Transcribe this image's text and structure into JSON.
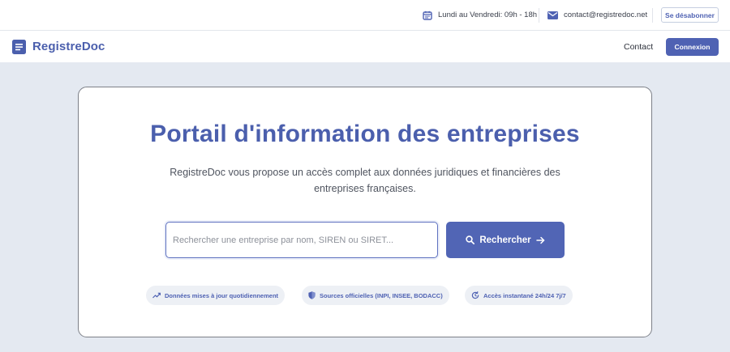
{
  "topbar": {
    "hours": "Lundi au Vendredi: 09h - 18h",
    "email": "contact@registredoc.net",
    "unsubscribe_label": "Se désabonner"
  },
  "navbar": {
    "brand": "RegistreDoc",
    "contact_label": "Contact",
    "login_label": "Connexion"
  },
  "hero": {
    "title": "Portail d'information des entreprises",
    "subtitle": "RegistreDoc vous propose un accès complet aux données juridiques et financières des entreprises françaises.",
    "search": {
      "placeholder": "Rechercher une entreprise par nom, SIREN ou SIRET...",
      "value": "",
      "button_label": "Rechercher"
    },
    "features": [
      {
        "label": "Données mises à jour quotidiennement",
        "icon": "trending-up-icon"
      },
      {
        "label": "Sources officielles (INPI, INSEE, BODACC)",
        "icon": "shield-icon"
      },
      {
        "label": "Accès instantané 24h/24 7j/7",
        "icon": "clock-refresh-icon"
      }
    ]
  },
  "colors": {
    "brand": "#4b5fad",
    "primary_button": "#5165b5",
    "page_background": "#e4e9f1"
  }
}
